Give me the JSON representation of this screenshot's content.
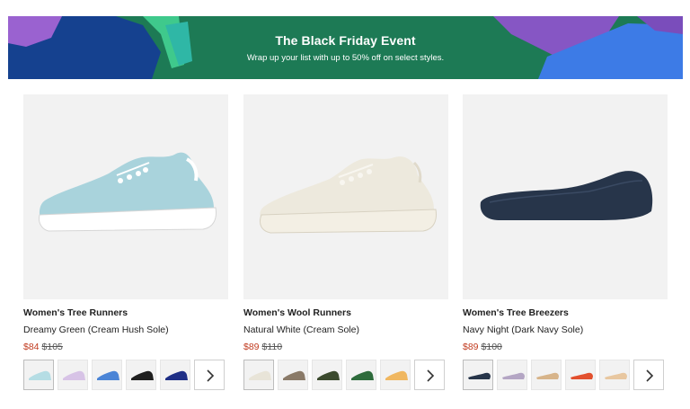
{
  "banner": {
    "title": "The Black Friday Event",
    "subtitle": "Wrap up your list with up to 50% off on select styles."
  },
  "products": [
    {
      "name": "Women's Tree Runners",
      "color_name": "Dreamy Green (Cream Hush Sole)",
      "sale_price": "$84",
      "original_price": "$105",
      "image_color": "#a9d3dc",
      "swatches": [
        "#b5dde4",
        "#d7c3e6",
        "#4a84d6",
        "#1f1f1f",
        "#1f2f86"
      ]
    },
    {
      "name": "Women's Wool Runners",
      "color_name": "Natural White (Cream Sole)",
      "sale_price": "$89",
      "original_price": "$110",
      "image_color": "#ede9dd",
      "swatches": [
        "#e8e4d8",
        "#8a7a68",
        "#3b4a2e",
        "#2e6b3c",
        "#f0b760"
      ]
    },
    {
      "name": "Women's Tree Breezers",
      "color_name": "Navy Night (Dark Navy Sole)",
      "sale_price": "$89",
      "original_price": "$100",
      "image_color": "#27354a",
      "swatches": [
        "#27354a",
        "#b4a6c4",
        "#d7b48a",
        "#e2502e",
        "#e8c7a0"
      ]
    }
  ],
  "colors": {
    "sale_price": "#c13a1e",
    "banner_green": "#1d7a55"
  },
  "icons": {
    "next": "chevron-right-icon"
  }
}
